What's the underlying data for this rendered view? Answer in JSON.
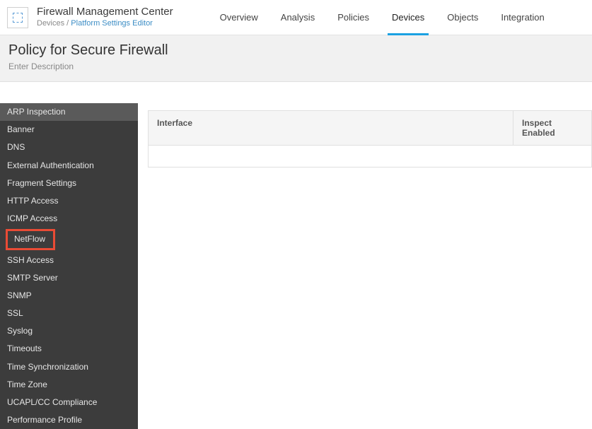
{
  "brand": {
    "title": "Firewall Management Center",
    "breadcrumb_root": "Devices",
    "breadcrumb_sep": " / ",
    "breadcrumb_leaf": "Platform Settings Editor"
  },
  "topnav": {
    "items": [
      "Overview",
      "Analysis",
      "Policies",
      "Devices",
      "Objects",
      "Integration"
    ],
    "active_index": 3
  },
  "titlebar": {
    "title": "Policy for Secure Firewall",
    "description": "Enter Description"
  },
  "sidebar": {
    "items": [
      "ARP Inspection",
      "Banner",
      "DNS",
      "External Authentication",
      "Fragment Settings",
      "HTTP Access",
      "ICMP Access",
      "NetFlow",
      "SSH Access",
      "SMTP Server",
      "SNMP",
      "SSL",
      "Syslog",
      "Timeouts",
      "Time Synchronization",
      "Time Zone",
      "UCAPL/CC Compliance",
      "Performance Profile"
    ],
    "selected_index": 0,
    "highlighted_index": 7
  },
  "table": {
    "columns": [
      "Interface",
      "Inspect Enabled"
    ]
  }
}
